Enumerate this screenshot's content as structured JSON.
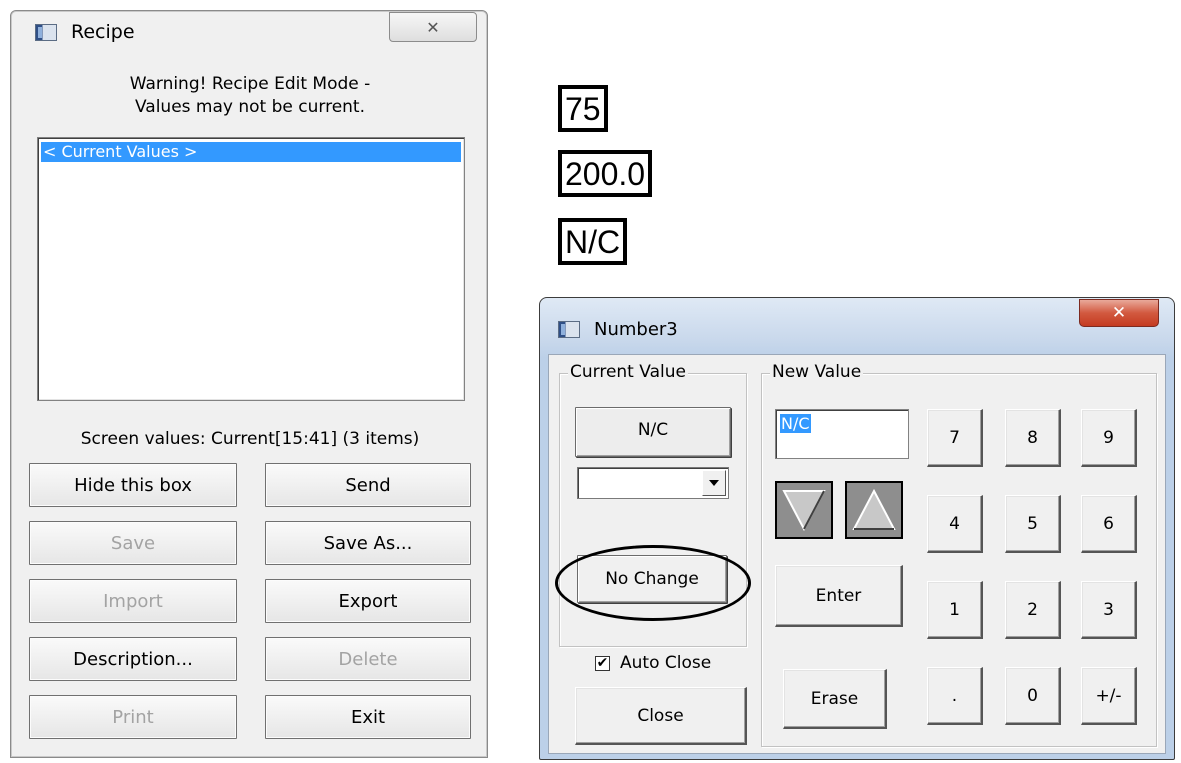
{
  "recipe_window": {
    "title": "Recipe",
    "close_glyph": "✕",
    "warning_line1": "Warning! Recipe Edit Mode -",
    "warning_line2": "Values may not be current.",
    "list_items": [
      "< Current Values >"
    ],
    "status": "Screen values: Current[15:41] (3 items)",
    "buttons": {
      "hide": "Hide this box",
      "send": "Send",
      "save": "Save",
      "save_as": "Save As...",
      "import": "Import",
      "export": "Export",
      "description": "Description...",
      "delete": "Delete",
      "print": "Print",
      "exit": "Exit"
    }
  },
  "value_boxes": [
    "75",
    "200.0",
    "N/C"
  ],
  "number_window": {
    "title": "Number3",
    "close_glyph": "✕",
    "current_value_label": "Current Value",
    "current_value": "N/C",
    "dropdown_value": "",
    "no_change": "No Change",
    "auto_close_label": "Auto Close",
    "auto_close_checked": true,
    "close": "Close",
    "new_value_label": "New Value",
    "new_value_input": "N/C",
    "enter": "Enter",
    "erase": "Erase",
    "keys": {
      "k7": "7",
      "k8": "8",
      "k9": "9",
      "k4": "4",
      "k5": "5",
      "k6": "6",
      "k1": "1",
      "k2": "2",
      "k3": "3",
      "dot": ".",
      "k0": "0",
      "plusminus": "+/-"
    }
  },
  "colors": {
    "selection": "#3399ff",
    "annotation_ellipse": "#000000",
    "close_red": "#c7463a"
  }
}
